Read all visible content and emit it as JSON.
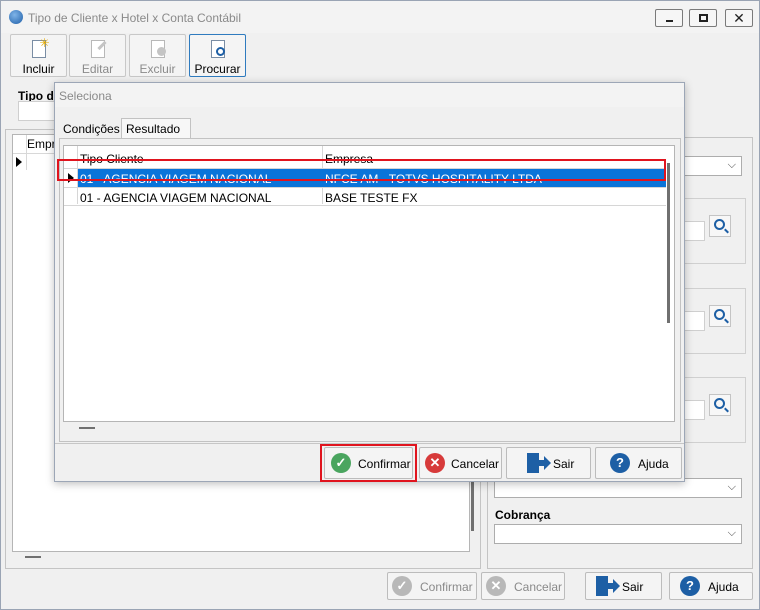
{
  "window": {
    "title": "Tipo de Cliente x Hotel x Conta Contábil",
    "close_glyph": "✕"
  },
  "toolbar": {
    "incluir": "Incluir",
    "editar": "Editar",
    "excluir": "Excluir",
    "procurar": "Procurar"
  },
  "left": {
    "tipo_label": "Tipo de",
    "grid_header": "Empre"
  },
  "right": {
    "cobranca_label": "Cobrança"
  },
  "main_buttons": {
    "confirmar": "Confirmar",
    "cancelar": "Cancelar",
    "sair": "Sair",
    "ajuda": "Ajuda"
  },
  "modal": {
    "title": "Seleciona",
    "tabs": [
      "Condições",
      "Resultado"
    ],
    "active_tab": "Resultado",
    "columns": [
      "Tipo Cliente",
      "Empresa"
    ],
    "rows": [
      {
        "tipo_cliente": "01 - AGENCIA VIAGEM NACIONAL",
        "empresa": "NFCE AM - TOTVS HOSPITALITY LTDA",
        "selected": true
      },
      {
        "tipo_cliente": "01 - AGENCIA VIAGEM NACIONAL",
        "empresa": "BASE TESTE FX",
        "selected": false
      }
    ],
    "buttons": {
      "confirmar": "Confirmar",
      "cancelar": "Cancelar",
      "sair": "Sair",
      "ajuda": "Ajuda"
    }
  },
  "icons": {
    "check": "✓",
    "x": "✕",
    "question": "?",
    "chevron": "⌵"
  },
  "colors": {
    "selection": "#0a74d9",
    "highlight": "#e0141e",
    "confirm_green": "#4aa55f",
    "cancel_red": "#d73a3a",
    "brand_blue": "#1d5fa5"
  }
}
